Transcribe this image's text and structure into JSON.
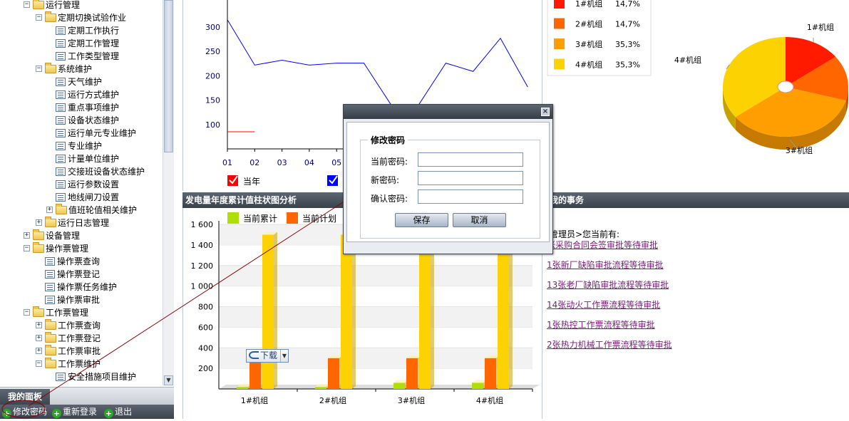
{
  "sidebar": {
    "tree": [
      {
        "label": "运行管理",
        "type": "folder",
        "toggle": "minus",
        "depth": 0
      },
      {
        "label": "定期切换试验作业",
        "type": "folder",
        "toggle": "minus",
        "depth": 1
      },
      {
        "label": "定期工作执行",
        "type": "doc",
        "depth": 2
      },
      {
        "label": "定期工作管理",
        "type": "doc",
        "depth": 2
      },
      {
        "label": "工作类型管理",
        "type": "doc",
        "depth": 2
      },
      {
        "label": "系统维护",
        "type": "folder",
        "toggle": "minus",
        "depth": 1
      },
      {
        "label": "天气维护",
        "type": "doc",
        "depth": 2
      },
      {
        "label": "运行方式维护",
        "type": "doc",
        "depth": 2
      },
      {
        "label": "重点事项维护",
        "type": "doc",
        "depth": 2
      },
      {
        "label": "设备状态维护",
        "type": "doc",
        "depth": 2
      },
      {
        "label": "运行单元专业维护",
        "type": "doc",
        "depth": 2
      },
      {
        "label": "专业维护",
        "type": "doc",
        "depth": 2
      },
      {
        "label": "计量单位维护",
        "type": "doc",
        "depth": 2
      },
      {
        "label": "交接班设备状态维护",
        "type": "doc",
        "depth": 2
      },
      {
        "label": "运行参数设置",
        "type": "doc",
        "depth": 2
      },
      {
        "label": "地线闸刀设置",
        "type": "doc",
        "depth": 2
      },
      {
        "label": "值班轮值相关维护",
        "type": "folder",
        "toggle": "plus",
        "depth": 2
      },
      {
        "label": "运行日志管理",
        "type": "folder",
        "toggle": "plus",
        "depth": 1
      },
      {
        "label": "设备管理",
        "type": "folder",
        "toggle": "plus",
        "depth": 0
      },
      {
        "label": "操作票管理",
        "type": "folder",
        "toggle": "minus",
        "depth": 0
      },
      {
        "label": "操作票查询",
        "type": "doc",
        "depth": 1
      },
      {
        "label": "操作票登记",
        "type": "doc",
        "depth": 1
      },
      {
        "label": "操作票任务维护",
        "type": "doc",
        "depth": 1
      },
      {
        "label": "操作票审批",
        "type": "doc",
        "depth": 1
      },
      {
        "label": "工作票管理",
        "type": "folder",
        "toggle": "minus",
        "depth": 0
      },
      {
        "label": "工作票查询",
        "type": "folder",
        "toggle": "plus",
        "depth": 1
      },
      {
        "label": "工作票登记",
        "type": "folder",
        "toggle": "plus",
        "depth": 1
      },
      {
        "label": "工作票审批",
        "type": "folder",
        "toggle": "plus",
        "depth": 1
      },
      {
        "label": "工作票维护",
        "type": "folder",
        "toggle": "minus",
        "depth": 1
      },
      {
        "label": "安全措施项目维护",
        "type": "doc",
        "depth": 2
      }
    ],
    "panel_tab": "我的面板",
    "actions": [
      {
        "label": "修改密码",
        "icon": "plus-circle-icon"
      },
      {
        "label": "重新登录",
        "icon": "plus-circle-icon"
      },
      {
        "label": "退出",
        "icon": "plus-circle-icon"
      }
    ]
  },
  "line_chart_panel": {
    "legend": [
      {
        "label": "当年",
        "color": "#ff0000",
        "checked": true
      },
      {
        "label": "",
        "color": "#0000ff",
        "checked": true
      }
    ]
  },
  "pie_legend": [
    {
      "label": "1#机组",
      "percent": "14,7%",
      "color": "#ff1a00"
    },
    {
      "label": "2#机组",
      "percent": "14,7%",
      "color": "#ff6600"
    },
    {
      "label": "3#机组",
      "percent": "35,3%",
      "color": "#ff9e01"
    },
    {
      "label": "4#机组",
      "percent": "35,3%",
      "color": "#fcd202"
    }
  ],
  "bar_panel": {
    "title": "发电量年度累计值柱状图分析",
    "download_label": "下载"
  },
  "todo_panel": {
    "title": "我的事务",
    "greeting": "管理员>您当前有:",
    "links": [
      "张采购合同会签审批等待审批",
      "1张新厂缺陷审批流程等待审批",
      "13张老厂缺陷审批流程等待审批",
      "14张动火工作票流程等待审批",
      "1张热控工作票流程等待审批",
      "2张热力机械工作票流程等待审批"
    ]
  },
  "modal": {
    "legend": "修改密码",
    "fields": [
      {
        "label": "当前密码:",
        "value": ""
      },
      {
        "label": "新密码:",
        "value": ""
      },
      {
        "label": "确认密码:",
        "value": ""
      }
    ],
    "save_label": "保存",
    "cancel_label": "取消"
  },
  "chart_data": [
    {
      "type": "line",
      "title": "",
      "xlabel": "",
      "ylabel": "",
      "x": [
        "01",
        "02",
        "03",
        "04",
        "05"
      ],
      "yticks": [
        100,
        150,
        200,
        250,
        300
      ],
      "ylim": [
        50,
        330
      ],
      "series": [
        {
          "name": "当年",
          "color": "#ff0000",
          "values": [
            85,
            85
          ]
        },
        {
          "name": "",
          "color": "#0000ff",
          "values": [
            315,
            222,
            232,
            222,
            226,
            226,
            140,
            140,
            226,
            209,
            277,
            177
          ]
        }
      ]
    },
    {
      "type": "pie",
      "categories": [
        "1#机组",
        "2#机组",
        "3#机组",
        "4#机组"
      ],
      "values": [
        14.7,
        14.7,
        35.3,
        35.3
      ],
      "colors": [
        "#ff1a00",
        "#ff6600",
        "#ff9e01",
        "#fcd202"
      ]
    },
    {
      "type": "bar",
      "title": "",
      "legend": [
        "当前累计",
        "当前计划"
      ],
      "categories": [
        "1#机组",
        "2#机组",
        "3#机组",
        "4#机组"
      ],
      "series": [
        {
          "name": "当前累计",
          "color": "#b0de09",
          "values": [
            20,
            20,
            60,
            60
          ]
        },
        {
          "name": "当前计划",
          "color": "#ff6600",
          "values": [
            260,
            300,
            300,
            300
          ]
        },
        {
          "name": "",
          "color": "#fcd202",
          "values": [
            1500,
            1500,
            1500,
            1500
          ]
        }
      ],
      "yticks": [
        "200",
        "400",
        "600",
        "800",
        "1 000",
        "1 200",
        "1 400",
        "1 600"
      ],
      "ylim": [
        0,
        1600
      ]
    }
  ]
}
